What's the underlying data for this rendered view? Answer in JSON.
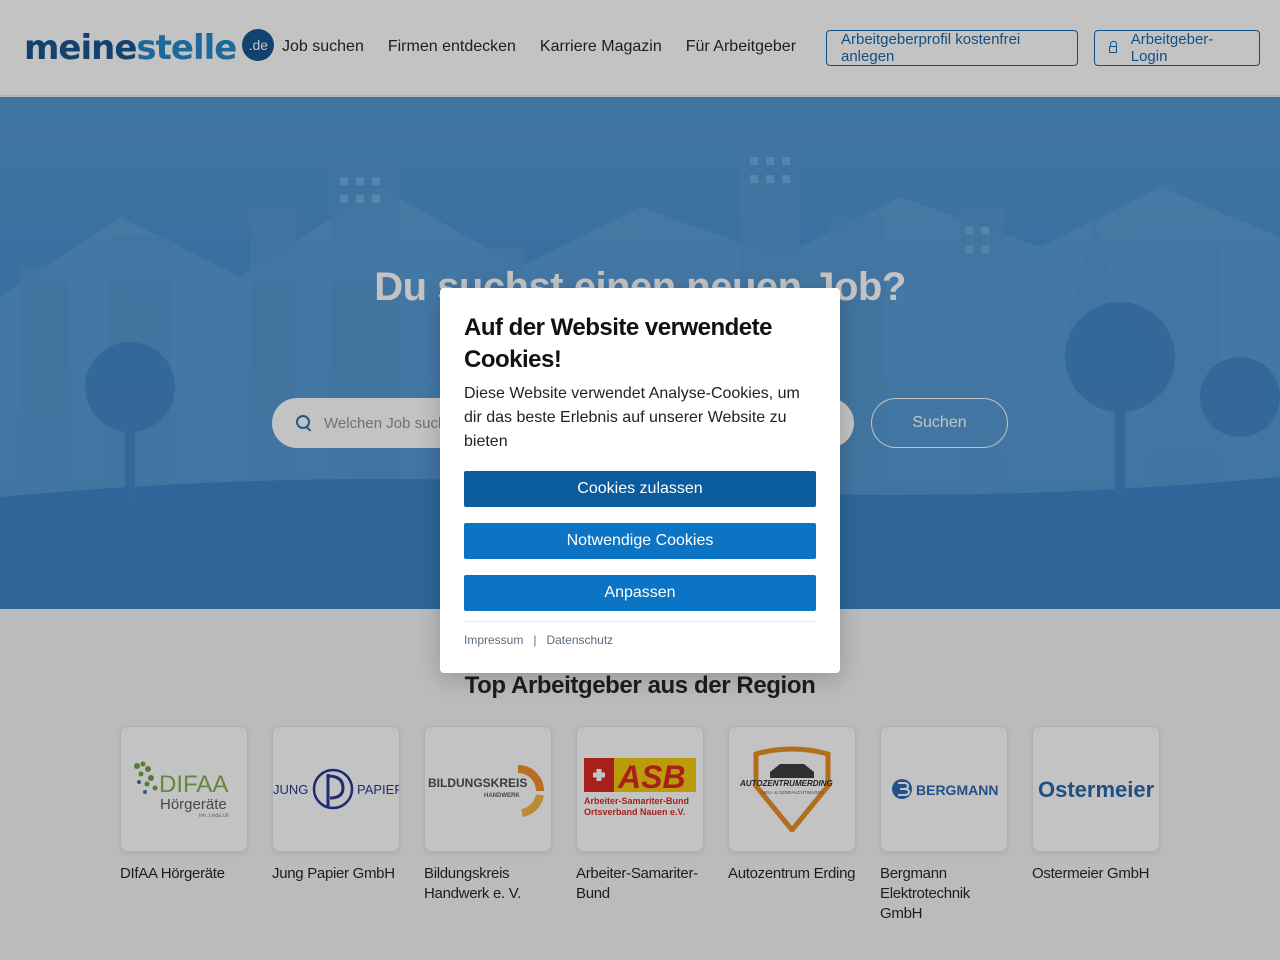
{
  "header": {
    "logo_main": "meine",
    "logo_accent": "stelle",
    "logo_badge": ".de",
    "nav": [
      "Job suchen",
      "Firmen entdecken",
      "Karriere Magazin",
      "Für Arbeitgeber"
    ],
    "profile_button": "Arbeitgeberprofil kostenfrei anlegen",
    "login_button": "Arbeitgeber-Login"
  },
  "hero": {
    "title": "Du suchst einen neuen Job?",
    "search_placeholder": "Welchen Job suchst du?",
    "search_button": "Suchen"
  },
  "employers_section": {
    "title": "Top Arbeitgeber aus der Region",
    "items": [
      {
        "name": "DIfAA Hörgeräte",
        "logo_main": "DIFAA",
        "logo_sub": "Hörgeräte",
        "logo_small": "Inh. Linda Lill"
      },
      {
        "name": "Jung Papier GmbH",
        "logo_left": "JUNG",
        "logo_right": "PAPIER"
      },
      {
        "name": "Bildungskreis Handwerk e. V.",
        "logo_main": "BILDUNGSKREIS",
        "logo_sub": "HANDWERK"
      },
      {
        "name": "Arbeiter-Samariter-Bund",
        "logo_main": "ASB",
        "logo_sub1": "Arbeiter-Samariter-Bund",
        "logo_sub2": "Ortsverband Nauen e.V."
      },
      {
        "name": "Autozentrum Erding",
        "logo_main": "AUTOZENTRUMERDING",
        "logo_sub": "NEU- & GEBRAUCHTWAGEN"
      },
      {
        "name": "Bergmann Elektrotechnik GmbH",
        "logo_main": "BERGMANN"
      },
      {
        "name": "Ostermeier GmbH",
        "logo_main": "Ostermeier"
      }
    ]
  },
  "cookie_modal": {
    "title": "Auf der Website verwendete Cookies!",
    "text": "Diese Website verwendet Analyse-Cookies, um dir das beste Erlebnis auf unserer Website zu bieten",
    "accept_button": "Cookies zulassen",
    "necessary_button": "Notwendige Cookies",
    "customize_button": "Anpassen",
    "link_imprint": "Impressum",
    "link_separator": "|",
    "link_privacy": "Datenschutz"
  },
  "colors": {
    "brand_dark": "#0b4d8a",
    "brand_light": "#1a83c9",
    "hero_blue": "#3a86cb",
    "button_primary": "#0a5c9e",
    "button_secondary": "#0c74c4"
  }
}
